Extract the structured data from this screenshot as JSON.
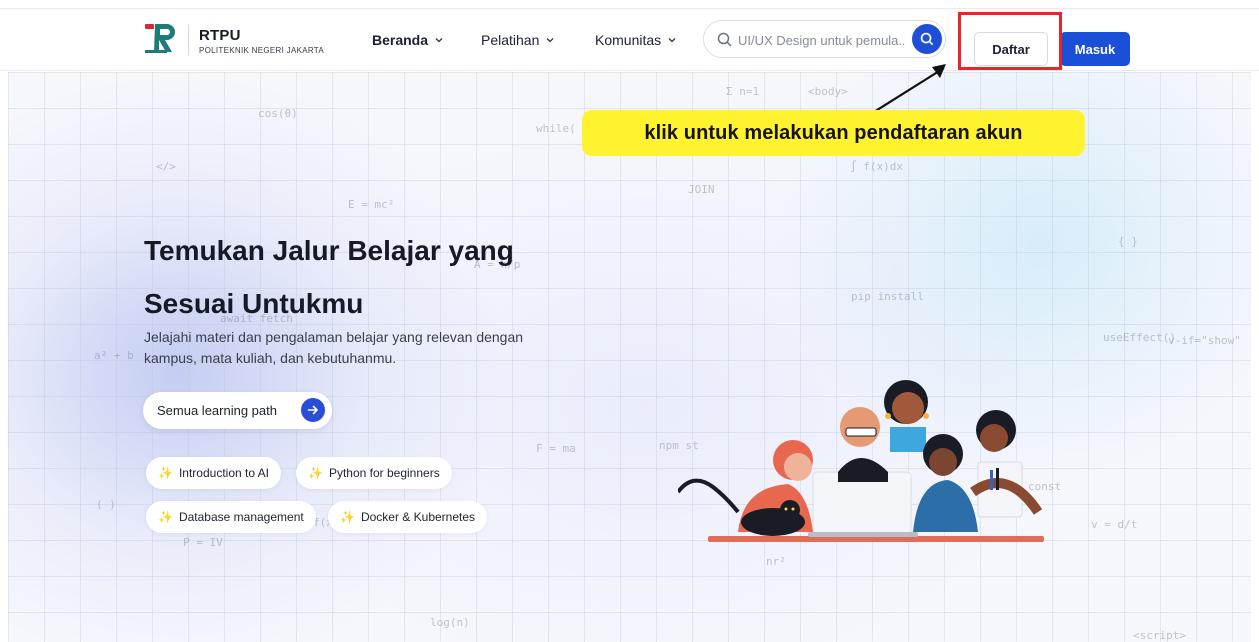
{
  "header": {
    "brand_name": "RTPU",
    "brand_sub": "POLITEKNIK NEGERI JAKARTA",
    "nav": [
      {
        "label": "Beranda"
      },
      {
        "label": "Pelatihan"
      },
      {
        "label": "Komunitas"
      }
    ],
    "search_placeholder": "UI/UX Design untuk pemula...",
    "daftar_label": "Daftar",
    "masuk_label": "Masuk"
  },
  "annotation": {
    "callout_text": "klik untuk melakukan pendaftaran akun"
  },
  "hero": {
    "title_line1": "Temukan Jalur Belajar yang",
    "title_line2": "Sesuai Untukmu",
    "description": "Jelajahi materi dan pengalaman belajar yang relevan dengan kampus, mata kuliah, dan kebutuhanmu.",
    "cta_label": "Semua learning path",
    "chips": [
      {
        "label": "Introduction to AI"
      },
      {
        "label": "Python for beginners"
      },
      {
        "label": "Database management"
      },
      {
        "label": "Docker & Kubernetes"
      }
    ],
    "doodles": [
      "cos(θ)",
      "</>",
      "E = mc²",
      "A = h/p",
      "await fetch",
      "a² + b",
      "( )",
      "P = IV",
      "while(",
      "Σ n=1",
      "<body>",
      "∫ f(x)dx",
      "JOIN",
      "pip install",
      "useEffect()",
      "v-if=\"show\"",
      "const",
      "v = d/t",
      "F = ma",
      "npm st",
      "nr²",
      "log(n)",
      "<script>",
      "{ }",
      "f(x)"
    ]
  },
  "colors": {
    "primary": "#1a4fd8",
    "annotation_red": "#e8252b",
    "callout_yellow": "#fff22e",
    "chip_spark": "#f2c043"
  }
}
